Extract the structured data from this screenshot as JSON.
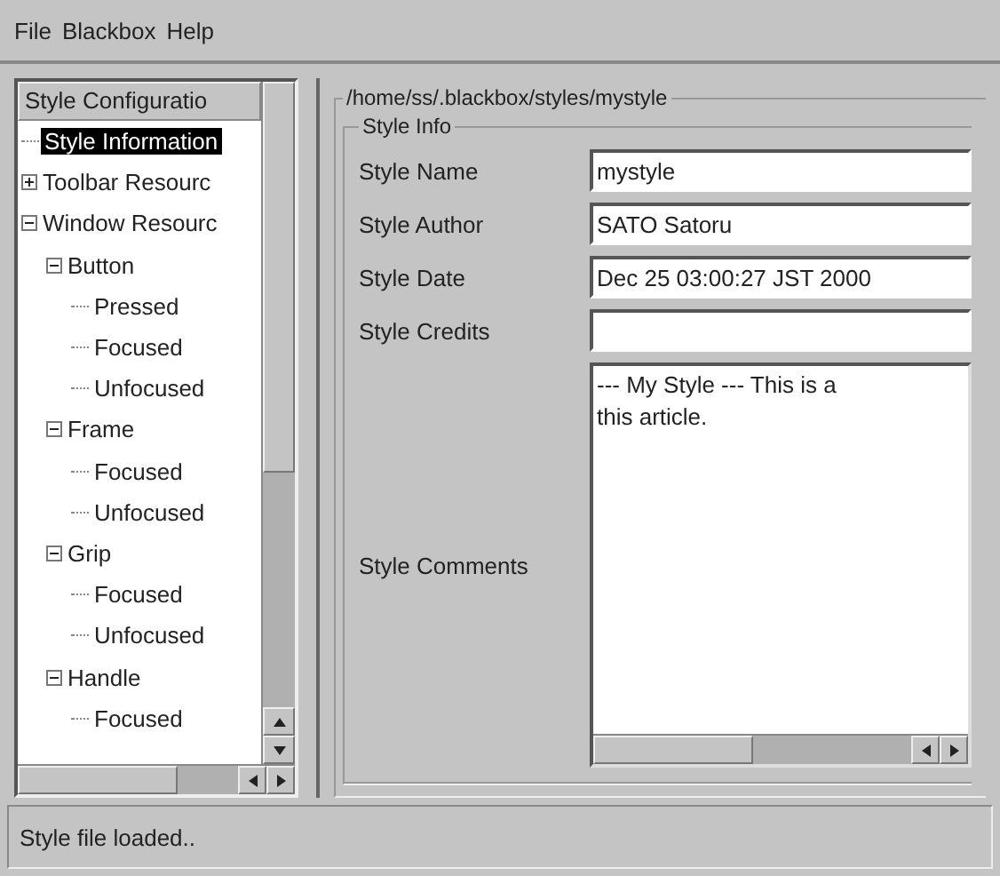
{
  "menu": [
    "File",
    "Blackbox",
    "Help"
  ],
  "tree": {
    "header": "Style Configuratio",
    "items": [
      {
        "label": "Style Information",
        "selected": true
      },
      {
        "label": "Toolbar Resourc",
        "selected": false,
        "expanded": false
      },
      {
        "label": "Window Resourc",
        "selected": false,
        "expanded": true,
        "children": [
          {
            "label": "Button",
            "selected": false,
            "expanded": true,
            "children": [
              {
                "label": "Pressed",
                "selected": false
              },
              {
                "label": "Focused",
                "selected": false
              },
              {
                "label": "Unfocused",
                "selected": false
              }
            ]
          },
          {
            "label": "Frame",
            "selected": false,
            "expanded": true,
            "children": [
              {
                "label": "Focused",
                "selected": false
              },
              {
                "label": "Unfocused",
                "selected": false
              }
            ]
          },
          {
            "label": "Grip",
            "selected": false,
            "expanded": true,
            "children": [
              {
                "label": "Focused",
                "selected": false
              },
              {
                "label": "Unfocused",
                "selected": false
              }
            ]
          },
          {
            "label": "Handle",
            "selected": false,
            "expanded": true,
            "children": [
              {
                "label": "Focused",
                "selected": false
              }
            ]
          }
        ]
      }
    ]
  },
  "path_group": {
    "title": "/home/ss/.blackbox/styles/mystyle"
  },
  "info_group": {
    "title": "Style Info",
    "fields": [
      {
        "label": "Style Name",
        "value": "mystyle"
      },
      {
        "label": "Style Author",
        "value": "SATO Satoru"
      },
      {
        "label": "Style Date",
        "value": "Dec 25 03:00:27 JST 2000"
      },
      {
        "label": "Style Credits"
      }
    ],
    "comments": {
      "label": "Style Comments",
      "lines": [
        "--- My Style --- This is a",
        "this article."
      ]
    }
  },
  "status_bar": "Style file loaded.."
}
